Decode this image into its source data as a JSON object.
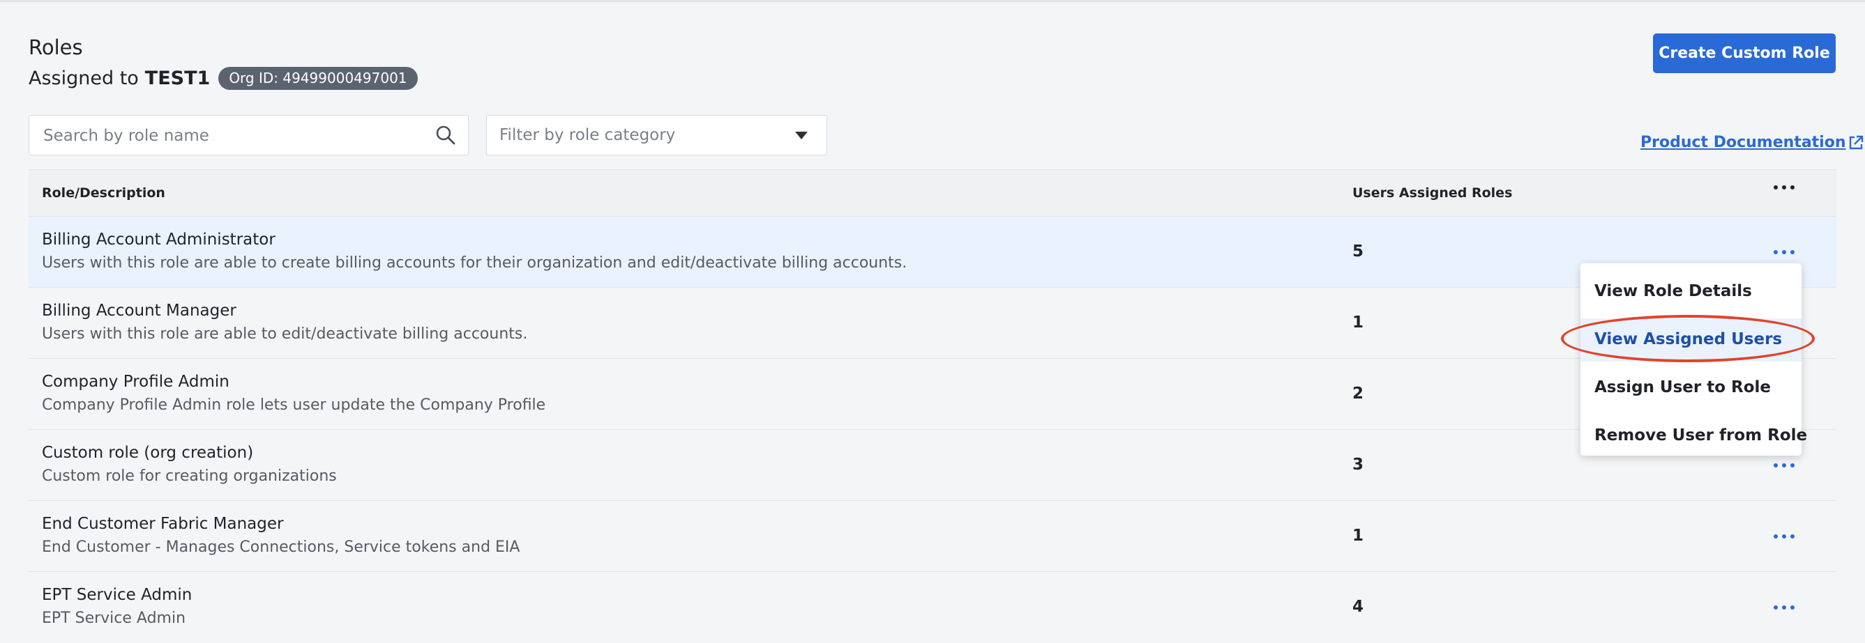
{
  "header": {
    "title": "Roles",
    "assigned_prefix": "Assigned to",
    "org_name": "TEST1",
    "org_badge": "Org ID: 49499000497001",
    "create_button": "Create Custom Role"
  },
  "search": {
    "placeholder": "Search by role name"
  },
  "filter": {
    "placeholder": "Filter by role category"
  },
  "doc_link": "Product Documentation",
  "table": {
    "columns": [
      "Role/Description",
      "Users Assigned Roles"
    ],
    "rows": [
      {
        "name": "Billing Account Administrator",
        "description": "Users with this role are able to create billing accounts for their organization and edit/deactivate billing accounts.",
        "users": "5"
      },
      {
        "name": "Billing Account Manager",
        "description": "Users with this role are able to edit/deactivate billing accounts.",
        "users": "1"
      },
      {
        "name": "Company Profile Admin",
        "description": "Company Profile Admin role lets user update the Company Profile",
        "users": "2"
      },
      {
        "name": "Custom role (org creation)",
        "description": "Custom role for creating organizations",
        "users": "3"
      },
      {
        "name": "End Customer Fabric Manager",
        "description": "End Customer - Manages Connections, Service tokens and EIA",
        "users": "1"
      },
      {
        "name": "EPT Service Admin",
        "description": "EPT Service Admin",
        "users": "4"
      }
    ]
  },
  "context_menu": {
    "items": [
      "View Role Details",
      "View Assigned Users",
      "Assign User to Role",
      "Remove User from Role"
    ],
    "active": "View Assigned Users"
  },
  "colors": {
    "primary": "#2a6ad6",
    "selected_row": "#eaf2fe",
    "badge": "#5b6370",
    "highlight": "#e0442c",
    "more_icon_blue": "#2a6ad6"
  },
  "icons": {
    "search": "search-icon",
    "caret": "caret-down-icon",
    "external": "external-link-icon",
    "more": "more-horizontal-icon"
  }
}
